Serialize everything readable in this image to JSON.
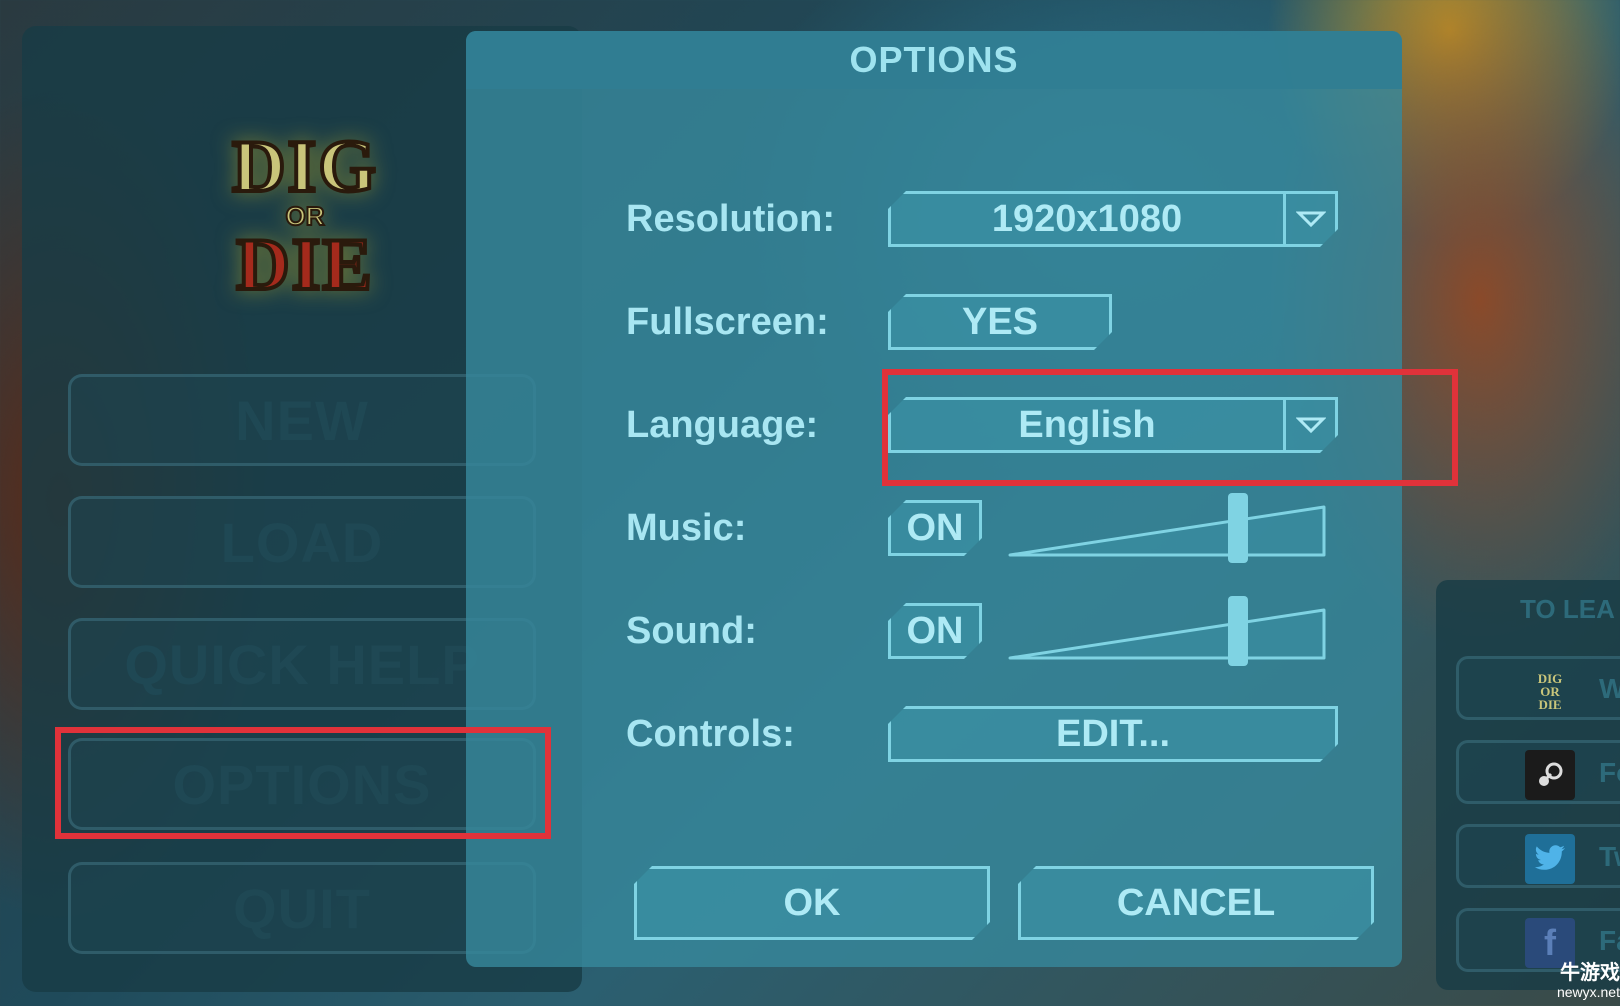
{
  "logo": {
    "line1": "DIG",
    "line2": "OR",
    "line3": "DIE"
  },
  "main_menu": {
    "items": [
      {
        "label": "NEW"
      },
      {
        "label": "LOAD"
      },
      {
        "label": "QUICK HELP"
      },
      {
        "label": "OPTIONS"
      },
      {
        "label": "QUIT"
      }
    ]
  },
  "dialog": {
    "title": "OPTIONS",
    "resolution": {
      "label": "Resolution:",
      "value": "1920x1080"
    },
    "fullscreen": {
      "label": "Fullscreen:",
      "value": "YES"
    },
    "language": {
      "label": "Language:",
      "value": "English"
    },
    "music": {
      "label": "Music:",
      "toggle": "ON",
      "level": 0.72
    },
    "sound": {
      "label": "Sound:",
      "toggle": "ON",
      "level": 0.72
    },
    "controls": {
      "label": "Controls:",
      "button": "EDIT..."
    },
    "ok_label": "OK",
    "cancel_label": "CANCEL"
  },
  "right_panel": {
    "title": "TO LEA",
    "links": [
      {
        "icon": "dig-or-die-wiki-icon",
        "text": "W"
      },
      {
        "icon": "steam-icon",
        "text": "Fo"
      },
      {
        "icon": "twitter-icon",
        "text": "Tw"
      },
      {
        "icon": "facebook-icon",
        "text": "Fa"
      }
    ]
  },
  "watermark": {
    "line1": "牛游戏",
    "line2": "newyx.net"
  },
  "colors": {
    "accent": "#7fd3e3",
    "text": "#a8e6f2",
    "highlight": "#e0323a",
    "dialog_bg": "#37879b"
  }
}
